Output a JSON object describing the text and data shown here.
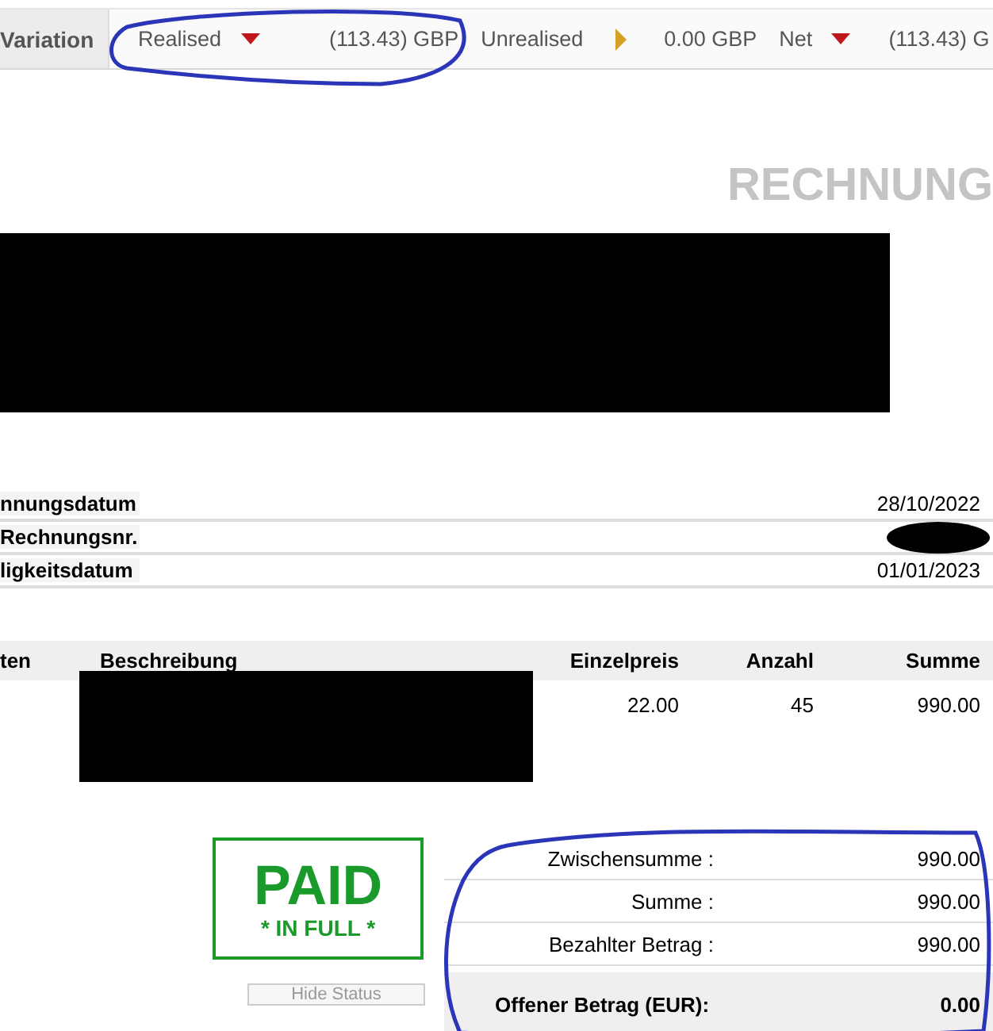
{
  "variation_bar": {
    "label": "Variation",
    "items": [
      {
        "label": "Realised",
        "kind": "down",
        "amount": "(113.43) GBP"
      },
      {
        "label": "Unrealised",
        "kind": "flat",
        "amount": "0.00 GBP"
      },
      {
        "label": "Net",
        "kind": "down",
        "amount": "(113.43) G"
      }
    ]
  },
  "document_title": "RECHNUNG",
  "invoice_info": [
    {
      "label": "nnungsdatum",
      "value": "28/10/2022"
    },
    {
      "label": "Rechnungsnr."
    },
    {
      "label": "ligkeitsdatum",
      "value": "01/01/2023"
    }
  ],
  "items_table": {
    "columns": [
      "ten",
      "Beschreibung",
      "Einzelpreis",
      "Anzahl",
      "Summe"
    ],
    "rows": [
      [
        "",
        "",
        "22.00",
        "45",
        "990.00"
      ]
    ]
  },
  "status_stamp": {
    "title": "PAID",
    "subtitle": "* IN FULL *"
  },
  "hide_status_button": "Hide Status",
  "totals": [
    {
      "label": "Zwischensumme :",
      "value": "990.00",
      "kind": "line"
    },
    {
      "label": "Summe :",
      "value": "990.00",
      "kind": "line"
    },
    {
      "label": "Bezahlter Betrag :",
      "value": "990.00",
      "kind": "line"
    },
    {
      "label": "Offener Betrag (EUR):",
      "value": "0.00",
      "kind": "due"
    }
  ]
}
